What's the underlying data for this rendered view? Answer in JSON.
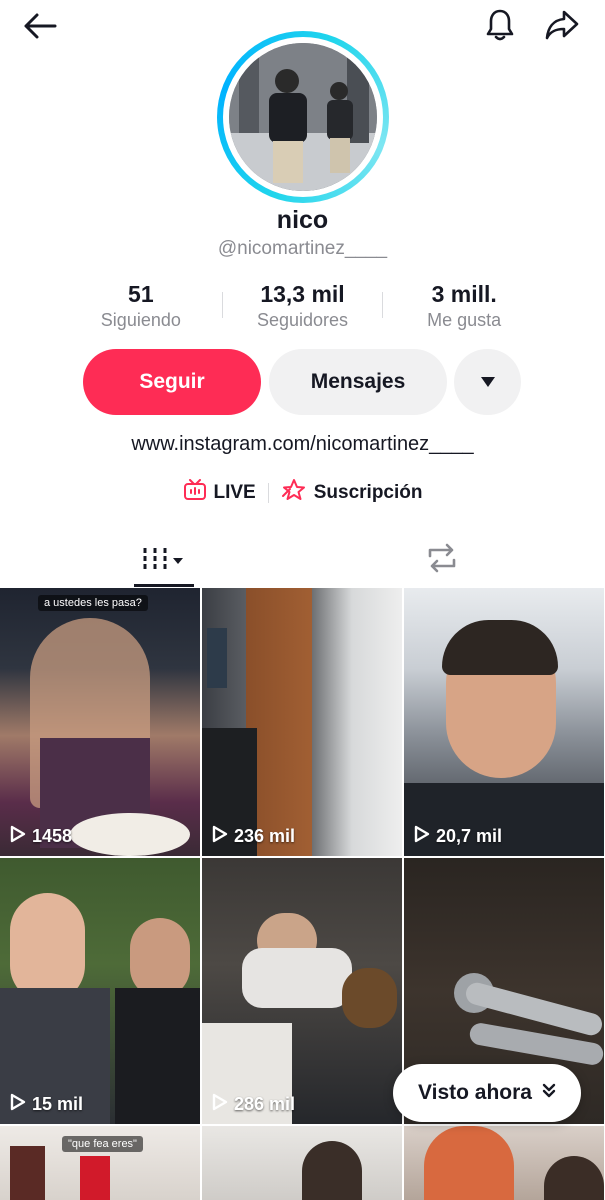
{
  "profile": {
    "name": "nico",
    "handle": "@nicomartinez____",
    "link": "www.instagram.com/nicomartinez____"
  },
  "stats": [
    {
      "value": "51",
      "label": "Siguiendo"
    },
    {
      "value": "13,3 mil",
      "label": "Seguidores"
    },
    {
      "value": "3 mill.",
      "label": "Me gusta"
    }
  ],
  "actions": {
    "follow": "Seguir",
    "messages": "Mensajes"
  },
  "badges": {
    "live": "LIVE",
    "subscription": "Suscripción"
  },
  "videos": [
    {
      "views": "1458",
      "caption": "a ustedes les pasa?"
    },
    {
      "views": "236 mil"
    },
    {
      "views": "20,7 mil"
    },
    {
      "views": "15 mil"
    },
    {
      "views": "286 mil"
    },
    {
      "views": ""
    },
    {
      "views": "",
      "caption": "\"que fea eres\""
    },
    {
      "views": ""
    },
    {
      "views": ""
    }
  ],
  "watched_now": "Visto ahora",
  "colors": {
    "accent": "#fe2c55",
    "text": "#161823",
    "muted": "#8a8b91",
    "ring": "#20d5ec"
  }
}
